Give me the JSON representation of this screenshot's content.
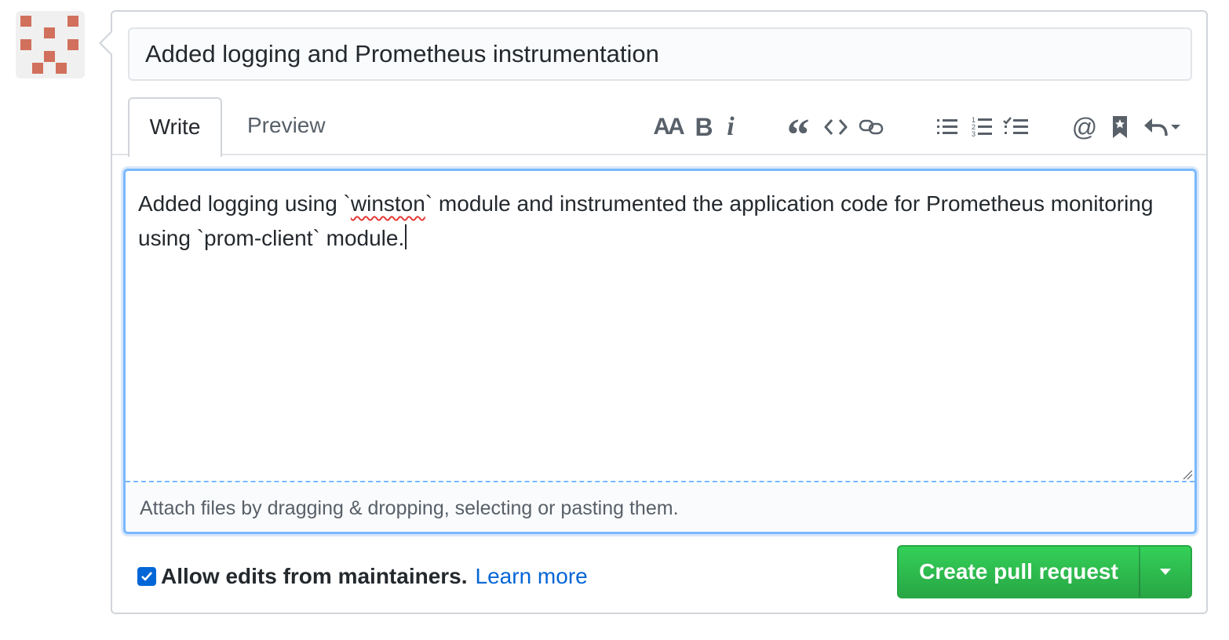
{
  "avatar": {
    "alt": "user avatar"
  },
  "pull_request": {
    "title": "Added logging and Prometheus instrumentation"
  },
  "tabs": [
    {
      "label": "Write",
      "active": true
    },
    {
      "label": "Preview",
      "active": false
    }
  ],
  "toolbar": {
    "heading_label": "AA",
    "bold_label": "B",
    "italic_label": "i",
    "quote_label": "“",
    "mention_label": "@",
    "tools": [
      "header-icon",
      "bold-icon",
      "italic-icon",
      "quote-icon",
      "code-icon",
      "link-icon",
      "unordered-list-icon",
      "ordered-list-icon",
      "task-list-icon",
      "mention-icon",
      "saved-reply-icon",
      "reply-icon"
    ]
  },
  "editor": {
    "body_before": "Added logging using `",
    "body_misspelled": "winston",
    "body_after": "` module and instrumented the application code for Prometheus monitoring using `prom-client` module.",
    "attach_text": "Attach files by dragging & dropping, selecting or pasting them."
  },
  "footer": {
    "allow_edits_label": "Allow edits from maintainers.",
    "allow_edits_checked": true,
    "learn_more_label": "Learn more",
    "create_button_label": "Create pull request"
  },
  "colors": {
    "primary_green": "#28a745",
    "link_blue": "#0366d6",
    "focus_blue": "#79b8ff",
    "avatar_color": "#d1705c"
  }
}
